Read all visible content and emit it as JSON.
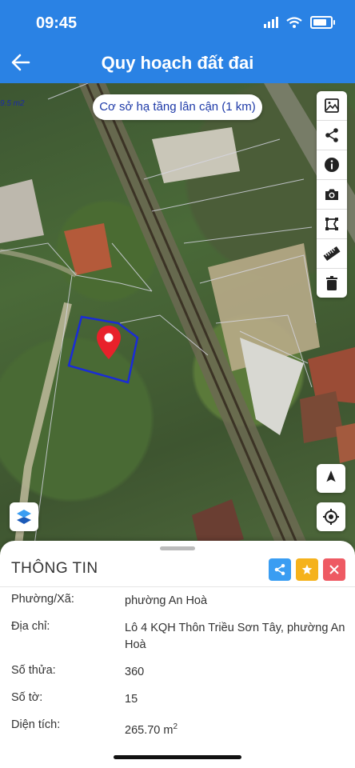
{
  "status": {
    "time": "09:45",
    "battery_level": 0.8
  },
  "header": {
    "title": "Quy hoạch đất đai",
    "back_icon": "arrow-left-icon"
  },
  "map": {
    "scale_label": "9.5 m2",
    "nearby_chip": "Cơ sở hạ tầng lân cận (1 km)",
    "tools": [
      "image-icon",
      "share-icon",
      "info-icon",
      "camera-icon",
      "polygon-select-icon",
      "ruler-icon",
      "trash-icon"
    ],
    "marker_icon": "map-pin-icon",
    "colors": {
      "marker": "#e8212a",
      "parcel_outline": "#1a2cd6"
    }
  },
  "info_panel": {
    "title": "THÔNG TIN",
    "buttons": [
      "share-icon",
      "star-icon",
      "close-icon"
    ],
    "button_colors": [
      "#3a9df2",
      "#f5b21c",
      "#ee5a63"
    ],
    "rows": [
      {
        "label": "Phường/Xã:",
        "value": "phường An Hoà"
      },
      {
        "label": "Địa chỉ:",
        "value": "Lô 4 KQH Thôn Triều Sơn Tây, phường An Hoà"
      },
      {
        "label": "Số thửa:",
        "value": "360"
      },
      {
        "label": "Số tờ:",
        "value": "15"
      },
      {
        "label": "Diện tích:",
        "value": "265.70 m",
        "unit_sup": "2"
      }
    ]
  }
}
